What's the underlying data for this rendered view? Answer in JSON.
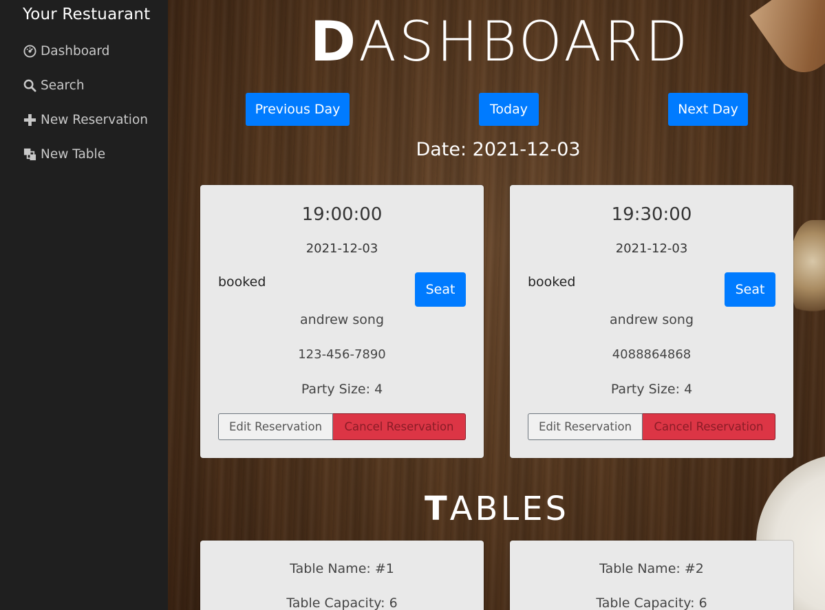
{
  "sidebar": {
    "brand": "Your Restuarant",
    "items": [
      {
        "label": "Dashboard",
        "icon": "dashboard-icon"
      },
      {
        "label": "Search",
        "icon": "search-icon"
      },
      {
        "label": "New Reservation",
        "icon": "plus-icon"
      },
      {
        "label": "New Table",
        "icon": "layers-icon"
      }
    ]
  },
  "header": {
    "title_first": "D",
    "title_rest": "ASHBOARD"
  },
  "nav": {
    "previous": "Previous Day",
    "today": "Today",
    "next": "Next Day"
  },
  "date_label": "Date: 2021-12-03",
  "reservations": [
    {
      "time": "19:00:00",
      "date": "2021-12-03",
      "status": "booked",
      "seat_label": "Seat",
      "name": "andrew song",
      "phone": "123-456-7890",
      "party": "Party Size: 4",
      "edit_label": "Edit Reservation",
      "cancel_label": "Cancel Reservation"
    },
    {
      "time": "19:30:00",
      "date": "2021-12-03",
      "status": "booked",
      "seat_label": "Seat",
      "name": "andrew song",
      "phone": "4088864868",
      "party": "Party Size: 4",
      "edit_label": "Edit Reservation",
      "cancel_label": "Cancel Reservation"
    }
  ],
  "tables_section": {
    "title_first": "T",
    "title_rest": "ABLES"
  },
  "tables": [
    {
      "name": "Table Name: #1",
      "capacity": "Table Capacity: 6"
    },
    {
      "name": "Table Name: #2",
      "capacity": "Table Capacity: 6"
    }
  ],
  "colors": {
    "sidebar_bg": "#1f1f1f",
    "primary": "#007bff",
    "danger": "#dc3545",
    "card_bg": "#e9e9e9"
  }
}
